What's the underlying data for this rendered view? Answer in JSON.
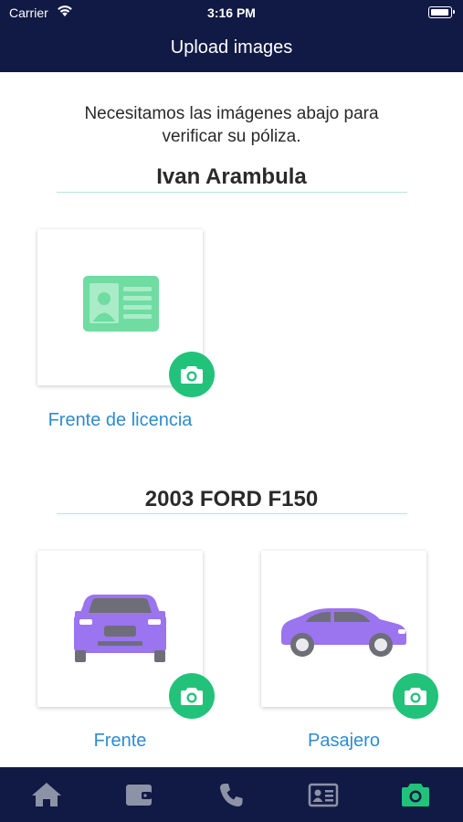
{
  "status_bar": {
    "carrier": "Carrier",
    "time": "3:16 PM"
  },
  "nav": {
    "title": "Upload images"
  },
  "intro": {
    "line1": "Necesitamos las imágenes abajo para",
    "line2": "verificar su póliza."
  },
  "driver_section": {
    "name": "Ivan Arambula",
    "cards": [
      {
        "label": "Frente de licencia",
        "icon": "driver-license-icon"
      }
    ]
  },
  "vehicle_section": {
    "name": "2003 FORD F150",
    "cards": [
      {
        "label": "Frente",
        "icon": "car-front-icon"
      },
      {
        "label": "Pasajero",
        "icon": "car-side-icon"
      }
    ]
  },
  "tab_bar": {
    "tabs": [
      {
        "icon": "home-icon",
        "active": false
      },
      {
        "icon": "wallet-icon",
        "active": false
      },
      {
        "icon": "phone-icon",
        "active": false
      },
      {
        "icon": "id-card-icon",
        "active": false
      },
      {
        "icon": "camera-icon",
        "active": true
      }
    ]
  },
  "colors": {
    "header_bg": "#111a45",
    "accent_green": "#22c27a",
    "license_green": "#6fdca2",
    "car_purple": "#9b74ef",
    "link_blue": "#2e8bd0",
    "tab_inactive": "#8d93a6"
  }
}
